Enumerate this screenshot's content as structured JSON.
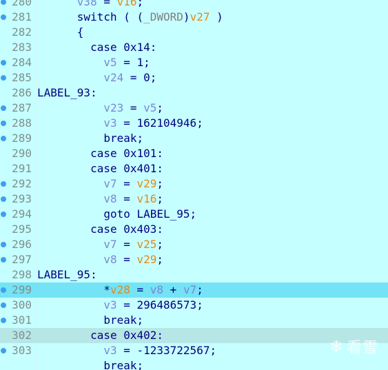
{
  "editor": {
    "watermark_text": "看雪",
    "colors": {
      "background": "#c6ffff",
      "current_line": "#73e3f5",
      "cursor_line": "#b7e6e6",
      "breakpoint": "#3ca0ef",
      "keyword": "#000080",
      "local_var": "#7a86d8",
      "arg_var": "#e08a1a"
    }
  },
  "lines": [
    {
      "n": "280",
      "bp": true,
      "hl": "",
      "indent": "      ",
      "tokens": [
        [
          "var",
          "v38"
        ],
        [
          "kw",
          " = "
        ],
        [
          "gvar",
          "v16"
        ],
        [
          "kw",
          ";"
        ]
      ]
    },
    {
      "n": "281",
      "bp": true,
      "hl": "",
      "indent": "      ",
      "tokens": [
        [
          "kw",
          "switch ( ("
        ],
        [
          "typ",
          "_DWORD"
        ],
        [
          "kw",
          ")"
        ],
        [
          "gvar",
          "v27"
        ],
        [
          "kw",
          " )"
        ]
      ]
    },
    {
      "n": "282",
      "bp": false,
      "hl": "",
      "indent": "      ",
      "tokens": [
        [
          "kw",
          "{"
        ]
      ]
    },
    {
      "n": "283",
      "bp": false,
      "hl": "",
      "indent": "        ",
      "tokens": [
        [
          "kw",
          "case 0x14:"
        ]
      ]
    },
    {
      "n": "284",
      "bp": true,
      "hl": "",
      "indent": "          ",
      "tokens": [
        [
          "var",
          "v5"
        ],
        [
          "kw",
          " = 1;"
        ]
      ]
    },
    {
      "n": "285",
      "bp": true,
      "hl": "",
      "indent": "          ",
      "tokens": [
        [
          "var",
          "v24"
        ],
        [
          "kw",
          " = 0;"
        ]
      ]
    },
    {
      "n": "286",
      "bp": false,
      "hl": "",
      "indent": "",
      "tokens": [
        [
          "kw",
          "LABEL_93:"
        ]
      ]
    },
    {
      "n": "287",
      "bp": true,
      "hl": "",
      "indent": "          ",
      "tokens": [
        [
          "var",
          "v23"
        ],
        [
          "kw",
          " = "
        ],
        [
          "var",
          "v5"
        ],
        [
          "kw",
          ";"
        ]
      ]
    },
    {
      "n": "288",
      "bp": true,
      "hl": "",
      "indent": "          ",
      "tokens": [
        [
          "var",
          "v3"
        ],
        [
          "kw",
          " = 162104946;"
        ]
      ]
    },
    {
      "n": "289",
      "bp": true,
      "hl": "",
      "indent": "          ",
      "tokens": [
        [
          "kw",
          "break;"
        ]
      ]
    },
    {
      "n": "290",
      "bp": false,
      "hl": "",
      "indent": "        ",
      "tokens": [
        [
          "kw",
          "case 0x101:"
        ]
      ]
    },
    {
      "n": "291",
      "bp": false,
      "hl": "",
      "indent": "        ",
      "tokens": [
        [
          "kw",
          "case 0x401:"
        ]
      ]
    },
    {
      "n": "292",
      "bp": true,
      "hl": "",
      "indent": "          ",
      "tokens": [
        [
          "var",
          "v7"
        ],
        [
          "kw",
          " = "
        ],
        [
          "gvar",
          "v29"
        ],
        [
          "kw",
          ";"
        ]
      ]
    },
    {
      "n": "293",
      "bp": true,
      "hl": "",
      "indent": "          ",
      "tokens": [
        [
          "var",
          "v8"
        ],
        [
          "kw",
          " = "
        ],
        [
          "gvar",
          "v16"
        ],
        [
          "kw",
          ";"
        ]
      ]
    },
    {
      "n": "294",
      "bp": true,
      "hl": "",
      "indent": "          ",
      "tokens": [
        [
          "kw",
          "goto LABEL_95;"
        ]
      ]
    },
    {
      "n": "295",
      "bp": false,
      "hl": "",
      "indent": "        ",
      "tokens": [
        [
          "kw",
          "case 0x403:"
        ]
      ]
    },
    {
      "n": "296",
      "bp": true,
      "hl": "",
      "indent": "          ",
      "tokens": [
        [
          "var",
          "v7"
        ],
        [
          "kw",
          " = "
        ],
        [
          "gvar",
          "v25"
        ],
        [
          "kw",
          ";"
        ]
      ]
    },
    {
      "n": "297",
      "bp": true,
      "hl": "",
      "indent": "          ",
      "tokens": [
        [
          "var",
          "v8"
        ],
        [
          "kw",
          " = "
        ],
        [
          "gvar",
          "v29"
        ],
        [
          "kw",
          ";"
        ]
      ]
    },
    {
      "n": "298",
      "bp": false,
      "hl": "",
      "indent": "",
      "tokens": [
        [
          "kw",
          "LABEL_95:"
        ]
      ]
    },
    {
      "n": "299",
      "bp": true,
      "hl": "current",
      "indent": "          ",
      "tokens": [
        [
          "kw",
          "*"
        ],
        [
          "gvar",
          "v28"
        ],
        [
          "kw",
          " = "
        ],
        [
          "var",
          "v8"
        ],
        [
          "kw",
          " + "
        ],
        [
          "var",
          "v7"
        ],
        [
          "kw",
          ";"
        ]
      ]
    },
    {
      "n": "300",
      "bp": true,
      "hl": "",
      "indent": "          ",
      "tokens": [
        [
          "var",
          "v3"
        ],
        [
          "kw",
          " = 296486573;"
        ]
      ]
    },
    {
      "n": "301",
      "bp": true,
      "hl": "",
      "indent": "          ",
      "tokens": [
        [
          "kw",
          "break;"
        ]
      ]
    },
    {
      "n": "302",
      "bp": false,
      "hl": "cursor",
      "indent": "        ",
      "tokens": [
        [
          "kw",
          "case 0x402:"
        ]
      ]
    },
    {
      "n": "303",
      "bp": true,
      "hl": "",
      "indent": "          ",
      "tokens": [
        [
          "var",
          "v3"
        ],
        [
          "kw",
          " = -1233722567;"
        ]
      ]
    },
    {
      "n": "",
      "bp": false,
      "hl": "",
      "indent": "          ",
      "tokens": [
        [
          "kw",
          "break;"
        ]
      ]
    }
  ]
}
